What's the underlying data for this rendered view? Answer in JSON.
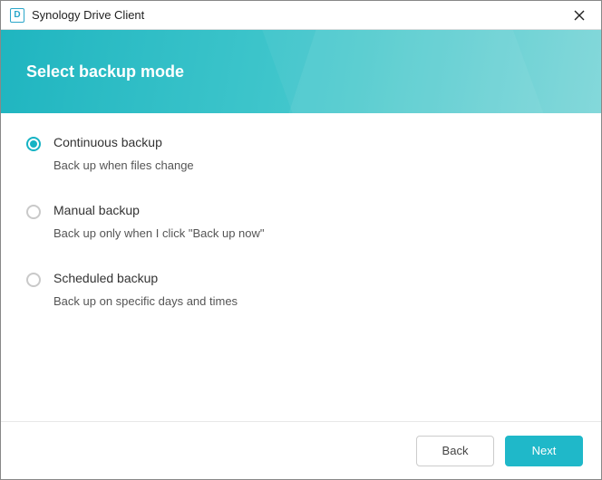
{
  "titlebar": {
    "app_name": "Synology Drive Client",
    "icon_letter": "D"
  },
  "header": {
    "title": "Select backup mode"
  },
  "options": [
    {
      "id": "continuous",
      "title": "Continuous backup",
      "description": "Back up when files change",
      "selected": true
    },
    {
      "id": "manual",
      "title": "Manual backup",
      "description": "Back up only when I click \"Back up now\"",
      "selected": false
    },
    {
      "id": "scheduled",
      "title": "Scheduled backup",
      "description": "Back up on specific days and times",
      "selected": false
    }
  ],
  "footer": {
    "back_label": "Back",
    "next_label": "Next"
  },
  "colors": {
    "accent": "#1fb8c9"
  }
}
